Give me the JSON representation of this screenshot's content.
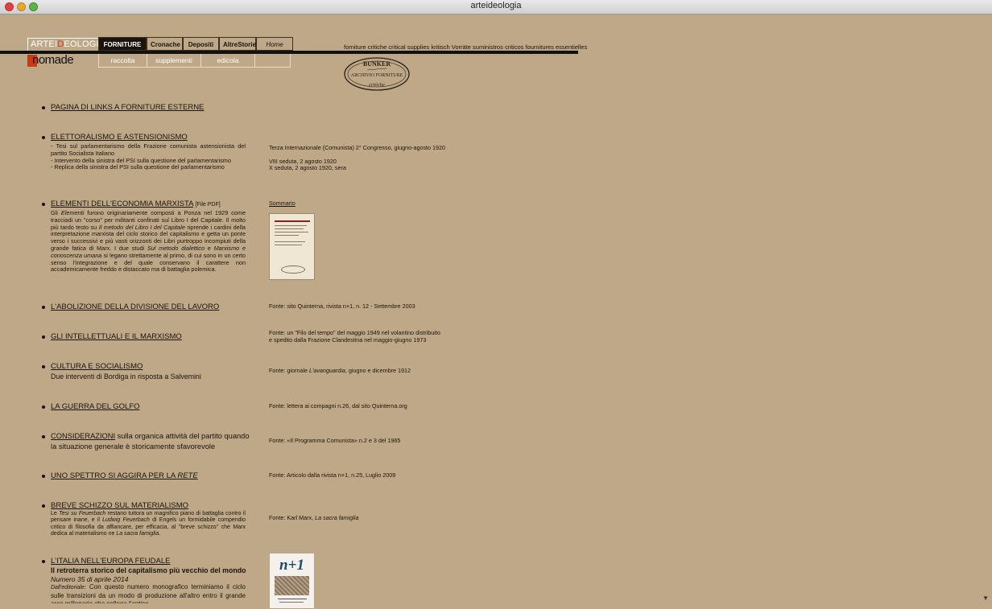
{
  "window": {
    "title": "arteideologia"
  },
  "header": {
    "logo_prefix": "ARTEI",
    "logo_d": "D",
    "logo_suffix": "EOLOGIA",
    "logo_nomade": "nomade",
    "nav_top": [
      "FORNITURE",
      "Cronache",
      "Depositi",
      "AltreStorie",
      "Home"
    ],
    "nav_bottom": [
      "raccolta",
      "supplementi",
      "edicola"
    ],
    "tagline": "forniture critiche critical supplies kritisch Vorräte suministros criticos fournitures essentielles",
    "stamp": {
      "top": "BUNKER",
      "middle": "ARCHIVIO FORNITURE",
      "bottom": "critiche"
    }
  },
  "entries": [
    {
      "title": "PAGINA DI LINKS A FORNITURE ESTERNE"
    },
    {
      "title": "ELETTORALISMO E ASTENSIONISMO",
      "lines": [
        "- Tesi sul parlamentarismo della Frazione comunista astensionista del partito Socialista Italiano",
        "- Intervento della sinistra del PSI sulla questione del parlamentarismo",
        "- Replica della sinistra del PSI sulla questione del parlamentarismo"
      ],
      "source": [
        "Terza Internazionale (Comunista) 2° Congresso, giugno-agosto 1920",
        "",
        "VIII seduta, 2 agosto 1920",
        "X seduta, 2 agosto 1920, sera"
      ]
    },
    {
      "title": "ELEMENTI DELL'ECONOMIA MARXISTA",
      "title_suffix": "[File PDF]",
      "desc_a": "Gli ",
      "desc_b": "Elementi",
      "desc_c": " furono originariamente composti a Ponza nel 1929 come tracciadi un \"corso\" per militanti confinati sul Libro I del Capitale. Il molto più tardo testo su ",
      "desc_d": "Il metodo del Libro I del Capitale",
      "desc_e": " riprende i cardini della interpretazione marxista del ciclo storico del capitalismo e getta un ponte verso i successivi e più vasti orizzonti dei Libri purtroppo incompiuti della grande fatica di Marx. I due studi ",
      "desc_f": "Sul metodo dialettico",
      "desc_g": " e ",
      "desc_h": "Marxismo e conoscenza umana",
      "desc_i": " si legano strettamente al primo, di cui sono in un certo senso l'integrazione e del quale conservano il carattere non accademicamente freddo e distaccato ma di battaglia polemica.",
      "source_link": "Sommario"
    },
    {
      "title": "L'ABOLIZIONE DELLA DIVISIONE DEL LAVORO",
      "source": [
        "Fonte: sito Quinterna, rivista n+1, n. 12 - Settembre 2003"
      ]
    },
    {
      "title": "GLI INTELLETTUALI E IL MARXISMO",
      "source": [
        "Fonte: un \"Filo del tempo\" del maggio 1949 nel volantino distribuito",
        "e spedito dalla Frazione Clandestina nel maggio-giugno 1973"
      ]
    },
    {
      "title": "CULTURA E SOCIALISMO",
      "subtitle": "Due interventi di Bordiga in risposta a Salvemini",
      "source_a": "Fonte: giornale ",
      "source_b": "L'avanguardia",
      "source_c": ", giugno e dicembre 1912"
    },
    {
      "title": "LA GUERRA DEL GOLFO",
      "source": [
        "Fonte: lettera ai compagni n.26, dal sito Quinterna.org"
      ]
    },
    {
      "title": "CONSIDERAZIONI",
      "title_rest_1": " sulla organica attività del partito quando",
      "title_rest_2": "la situazione generale è storicamente sfavorevole",
      "source": [
        "Fonte: «Il Programma Comunista» n.2 e 3 del 1965"
      ]
    },
    {
      "title_a": "UNO SPETTRO SI AGGIRA PER LA ",
      "title_b": "RETE",
      "source": [
        "Fonte: Articolo dalla rivista n+1, n.25, Luglio 2009"
      ]
    },
    {
      "title": "BREVE SCHIZZO SUL MATERIALISMO",
      "d1": "Le ",
      "d2": "Tesi su Feuerbach",
      "d3": " restano tuttora un magnifico piano di battaglia contro il pensare inane, e il ",
      "d4": "Ludwig Feuerbach",
      "d5": " di Engels un formidabile compendio critico di filosofia da affiancare, per efficacia, al \"breve schizzo\" che Marx dedica al materialismo ne ",
      "d6": "La sacra famiglia",
      "d7": ".",
      "source_a": "Fonte: Karl Marx, ",
      "source_b": "La sacra famiglia"
    },
    {
      "title": "L'ITALIA NELL'EUROPA FEUDALE",
      "subtitle": "Il retroterra storico del capitalismo più vecchio del mondo",
      "issue": "Numero 35 di aprile 2014",
      "ed_label": "Dall'editoriale:",
      "ed_text": " Con questo numero monografico terminiamo il ciclo sulle transizioni da un modo di produzione all'altro entro il grande arco millenario che collega l'antico",
      "cover_title": "n+1"
    }
  ]
}
